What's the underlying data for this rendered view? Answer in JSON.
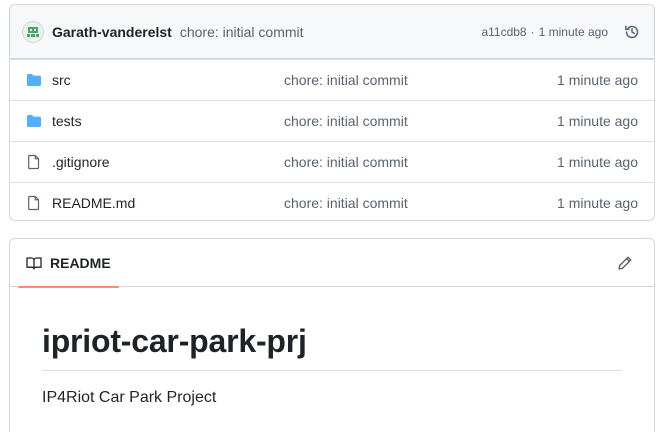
{
  "latest_commit": {
    "author": "Garath-vanderelst",
    "message": "chore: initial commit",
    "sha": "a11cdb8",
    "separator": "·",
    "time": "1 minute ago"
  },
  "files": [
    {
      "name": "src",
      "type": "folder",
      "commit": "chore: initial commit",
      "time": "1 minute ago"
    },
    {
      "name": "tests",
      "type": "folder",
      "commit": "chore: initial commit",
      "time": "1 minute ago"
    },
    {
      "name": ".gitignore",
      "type": "file",
      "commit": "chore: initial commit",
      "time": "1 minute ago"
    },
    {
      "name": "README.md",
      "type": "file",
      "commit": "chore: initial commit",
      "time": "1 minute ago"
    }
  ],
  "readme": {
    "tab_label": "README",
    "title": "ipriot-car-park-prj",
    "description": "IP4Riot Car Park Project"
  },
  "colors": {
    "folder": "#54aeff",
    "tab_underline": "#fd8c73",
    "muted": "#59636e"
  }
}
